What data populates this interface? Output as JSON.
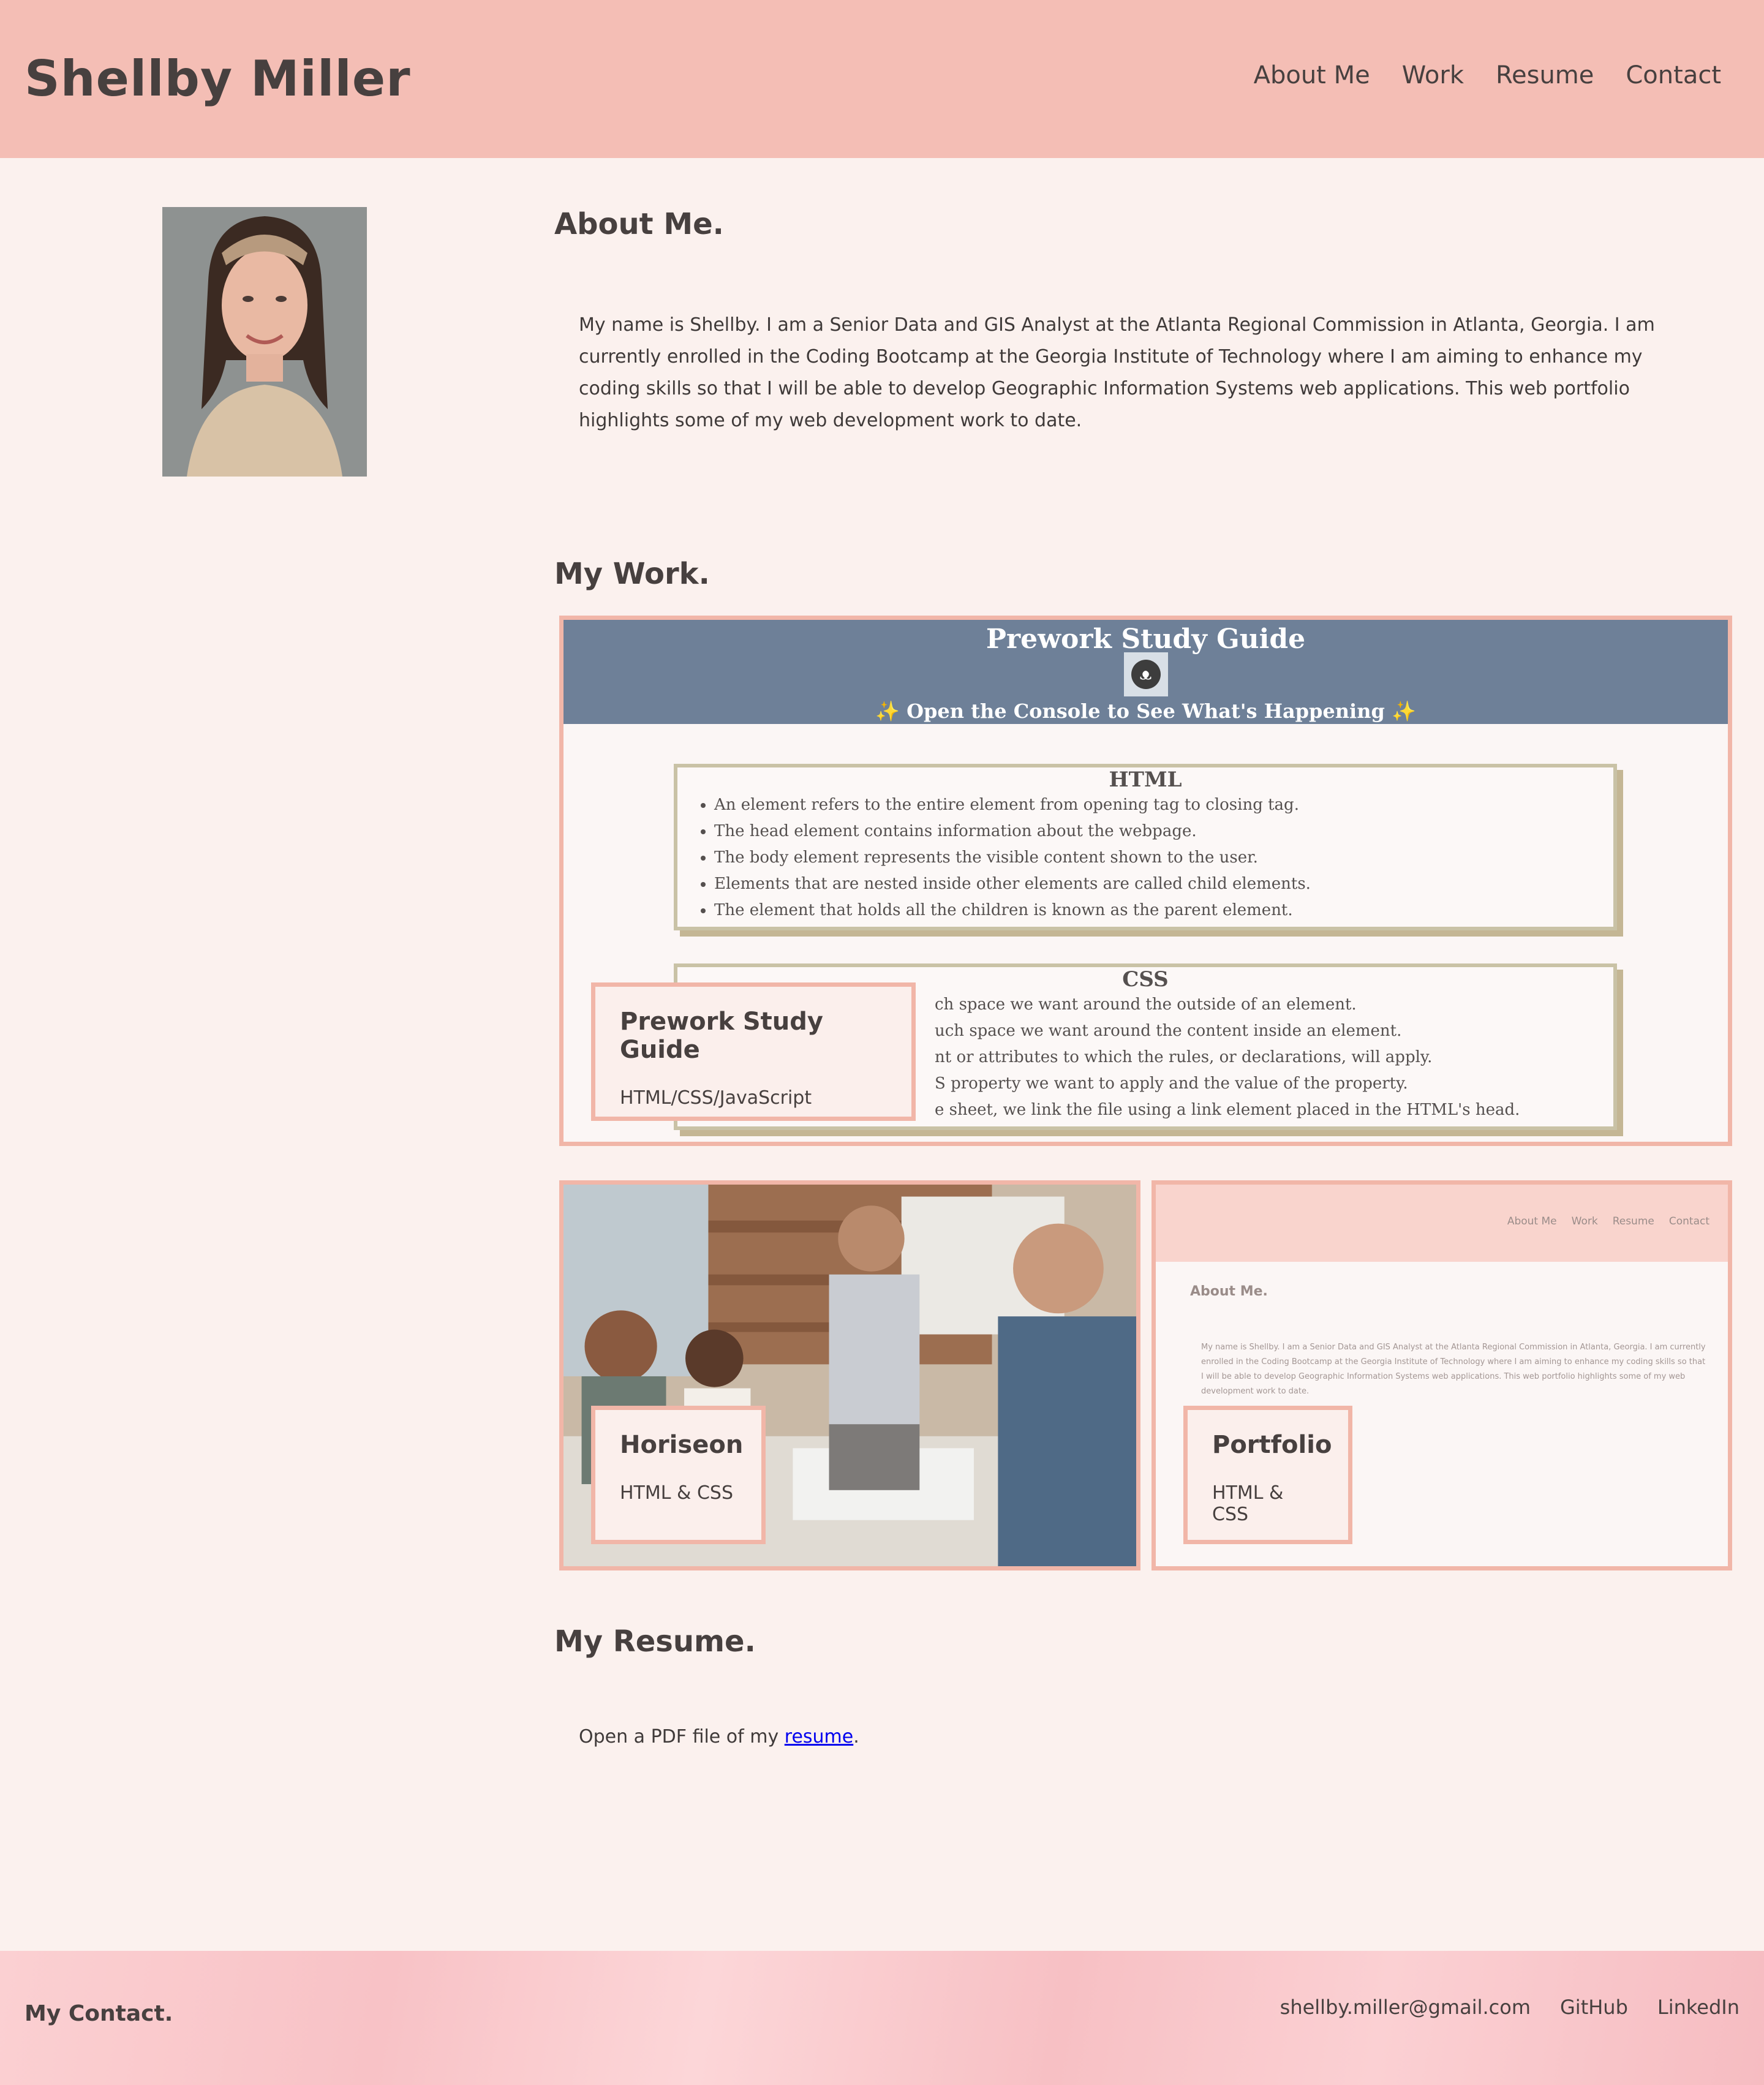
{
  "header": {
    "title": "Shellby Miller",
    "nav": [
      "About Me",
      "Work",
      "Resume",
      "Contact"
    ]
  },
  "about": {
    "heading": "About Me.",
    "text": "My name is Shellby. I am a Senior Data and GIS Analyst at the Atlanta Regional Commission in Atlanta, Georgia. I am currently enrolled in the Coding Bootcamp at the Georgia Institute of Technology where I am aiming to enhance my coding skills so that I will be able to develop Geographic Information Systems web applications. This web portfolio highlights some of my web development work to date."
  },
  "work": {
    "heading": "My Work.",
    "projects": [
      {
        "title": "Prework Study Guide",
        "tech": "HTML/CSS/JavaScript"
      },
      {
        "title": "Horiseon",
        "tech": "HTML & CSS"
      },
      {
        "title": "Portfolio",
        "tech": "HTML & CSS"
      }
    ],
    "study_guide_preview": {
      "title": "Prework Study Guide",
      "console": "✨ Open the Console to See What's Happening ✨",
      "html_heading": "HTML",
      "html_items": [
        "An element refers to the entire element from opening tag to closing tag.",
        "The head element contains information about the webpage.",
        "The body element represents the visible content shown to the user.",
        "Elements that are nested inside other elements are called child elements.",
        "The element that holds all the children is known as the parent element."
      ],
      "css_heading": "CSS",
      "css_items": [
        "ch space we want around the outside of an element.",
        "uch space we want around the content inside an element.",
        "nt or attributes to which the rules, or declarations, will apply.",
        "S property we want to apply and the value of the property.",
        "e sheet, we link the file using a link element placed in the HTML's head."
      ]
    },
    "portfolio_preview": {
      "nav": [
        "About Me",
        "Work",
        "Resume",
        "Contact"
      ],
      "heading": "About Me.",
      "text": "My name is Shellby. I am a Senior Data and GIS Analyst at the Atlanta Regional Commission in Atlanta, Georgia. I am currently enrolled in the Coding Bootcamp at the Georgia Institute of Technology where I am aiming to enhance my coding skills so that I will be able to develop Geographic Information Systems web applications. This web portfolio highlights some of my web development work to date."
    }
  },
  "resume": {
    "heading": "My Resume.",
    "text_before": "Open a PDF file of my ",
    "link": "resume",
    "text_after": "."
  },
  "footer": {
    "title": "My Contact.",
    "links": [
      "shellby.miller@gmail.com",
      "GitHub",
      "LinkedIn"
    ]
  },
  "colors": {
    "header_bg": "#f4beb5",
    "page_bg": "#fbf1ee",
    "text": "#47403f",
    "card_border": "#f1b6a8",
    "study_guide_header": "#6e8098"
  }
}
